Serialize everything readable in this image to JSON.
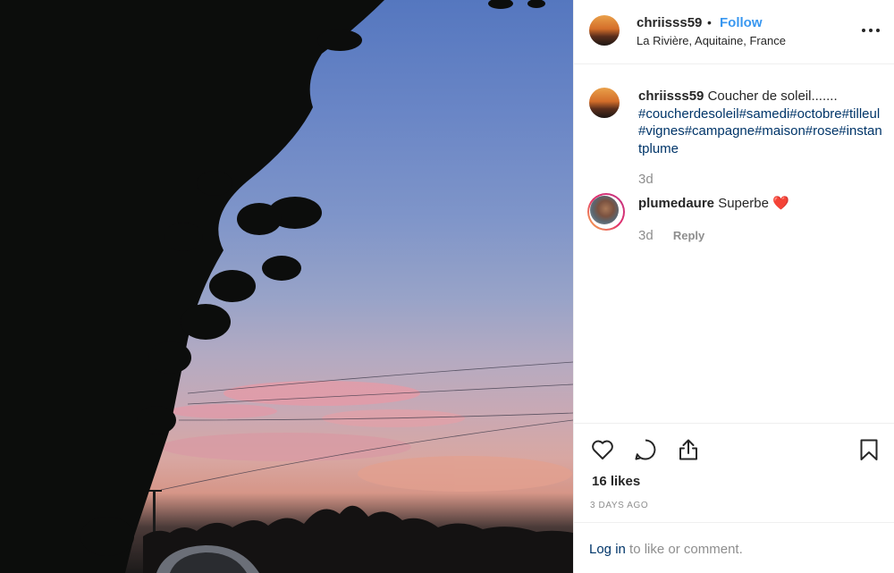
{
  "post": {
    "username": "chriisss59",
    "separator": "•",
    "follow_label": "Follow",
    "location": "La Rivière, Aquitaine, France",
    "more_icon": "more-horizontal-icon"
  },
  "caption": {
    "username": "chriisss59",
    "text": "Coucher de soleil.......",
    "hashtags": "#coucherdesoleil#samedi#octobre#tilleul#vignes#campagne#maison#rose#instantplume",
    "age": "3d"
  },
  "comments": [
    {
      "username": "plumedaure",
      "text": "Superbe",
      "emoji": "❤️",
      "age": "3d",
      "reply_label": "Reply"
    }
  ],
  "actions": {
    "icons": [
      "heart-icon",
      "comment-icon",
      "share-icon",
      "bookmark-icon"
    ],
    "likes": "16 likes",
    "date": "3 DAYS AGO"
  },
  "login": {
    "link_label": "Log in",
    "suffix": " to like or comment."
  },
  "colors": {
    "link_blue": "#3897f0",
    "hashtag": "#003569",
    "muted": "#8e8e8e",
    "text": "#262626"
  }
}
